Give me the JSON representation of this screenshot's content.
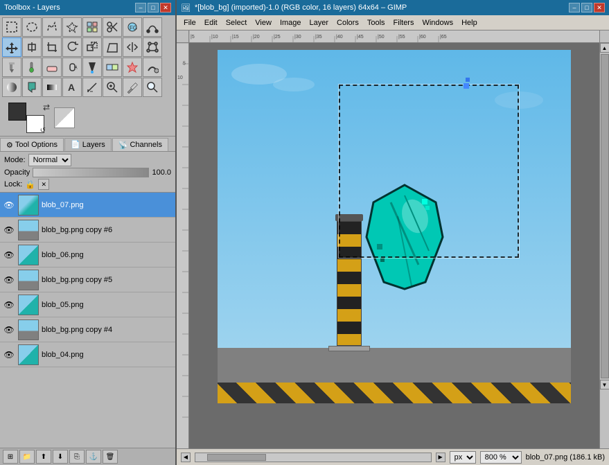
{
  "toolbox_window": {
    "title": "Toolbox - Layers"
  },
  "gimp_window": {
    "title": "*[blob_bg] (imported)-1.0 (RGB color, 16 layers) 64x64 – GIMP",
    "minimize": "–",
    "maximize": "□",
    "close": "✕"
  },
  "menu": {
    "items": [
      "File",
      "Edit",
      "Select",
      "View",
      "Image",
      "Layer",
      "Colors",
      "Tools",
      "Filters",
      "Windows",
      "Help"
    ]
  },
  "tool_options": {
    "mode_label": "Mode:",
    "mode_value": "Normal",
    "opacity_label": "Opacity",
    "opacity_value": "100.0",
    "lock_label": "Lock:"
  },
  "tabs": [
    {
      "id": "tool-options",
      "label": "Tool Options",
      "icon": "⚙"
    },
    {
      "id": "layers",
      "label": "Layers",
      "icon": "📄"
    },
    {
      "id": "channels",
      "label": "Channels",
      "icon": "📡"
    }
  ],
  "layers": [
    {
      "id": 1,
      "name": "blob_07.png",
      "visible": true,
      "active": true,
      "thumb_class": "thumb-blob07"
    },
    {
      "id": 2,
      "name": "blob_bg.png copy #6",
      "visible": true,
      "active": false,
      "thumb_class": "thumb-blobcopy6"
    },
    {
      "id": 3,
      "name": "blob_06.png",
      "visible": true,
      "active": false,
      "thumb_class": "thumb-blob06"
    },
    {
      "id": 4,
      "name": "blob_bg.png copy #5",
      "visible": true,
      "active": false,
      "thumb_class": "thumb-blobcopy5"
    },
    {
      "id": 5,
      "name": "blob_05.png",
      "visible": true,
      "active": false,
      "thumb_class": "thumb-blob05"
    },
    {
      "id": 6,
      "name": "blob_bg.png copy #4",
      "visible": true,
      "active": false,
      "thumb_class": "thumb-blobcopy4"
    },
    {
      "id": 7,
      "name": "blob_04.png",
      "visible": true,
      "active": false,
      "thumb_class": "thumb-blob04"
    }
  ],
  "layer_toolbar": {
    "buttons": [
      "⬇",
      "⬆",
      "new",
      "copy",
      "del"
    ]
  },
  "status": {
    "unit": "px",
    "zoom": "800 %",
    "filename": "blob_07.png (186.1 kB)"
  },
  "tools": [
    [
      "rect-select",
      "ellipse-select",
      "free-select",
      "fuzzy-select",
      "by-color-select",
      "scissors",
      "foreground-extract",
      "paths"
    ],
    [
      "move",
      "align",
      "transform",
      "rotate",
      "scale",
      "perspective",
      "flip",
      "cage"
    ],
    [
      "pencil",
      "paintbrush",
      "eraser",
      "airbrush",
      "ink",
      "clone",
      "heal",
      "smudge"
    ],
    [
      "dodge-burn",
      "fill",
      "gradient",
      "text",
      "measure",
      "zoom",
      "color-picker",
      "magnify"
    ]
  ]
}
